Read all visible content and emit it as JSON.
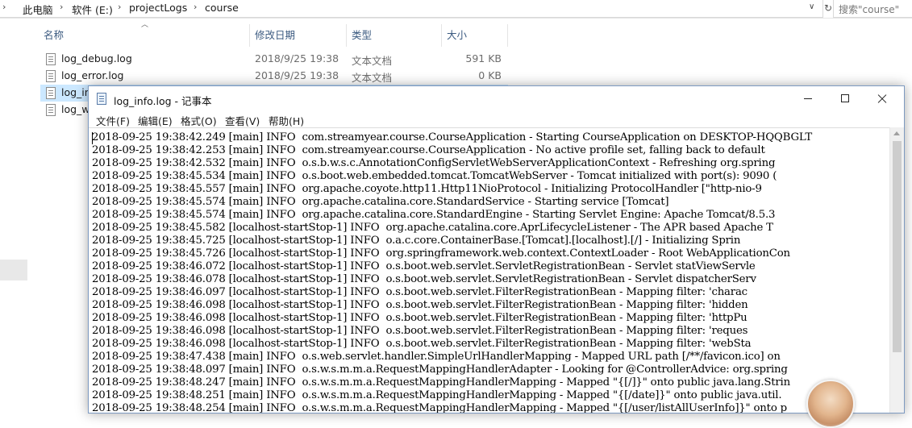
{
  "explorer": {
    "breadcrumb": [
      "此电脑",
      "软件 (E:)",
      "projectLogs",
      "course"
    ],
    "search_placeholder": "搜索\"course\"",
    "columns": [
      "名称",
      "修改日期",
      "类型",
      "大小"
    ],
    "files": [
      {
        "name": "log_debug.log",
        "date": "2018/9/25 19:38",
        "type": "文本文档",
        "size": "591 KB"
      },
      {
        "name": "log_error.log",
        "date": "2018/9/25 19:38",
        "type": "文本文档",
        "size": "0 KB"
      },
      {
        "name": "log_in",
        "date": "",
        "type": "",
        "size": ""
      },
      {
        "name": "log_w",
        "date": "",
        "type": "",
        "size": ""
      }
    ]
  },
  "notepad": {
    "title": "log_info.log - 记事本",
    "menus": [
      "文件(F)",
      "编辑(E)",
      "格式(O)",
      "查看(V)",
      "帮助(H)"
    ],
    "lines": [
      "2018-09-25 19:38:42.249 [main] INFO  com.streamyear.course.CourseApplication - Starting CourseApplication on DESKTOP-HQQBGLT",
      "2018-09-25 19:38:42.253 [main] INFO  com.streamyear.course.CourseApplication - No active profile set, falling back to default",
      "2018-09-25 19:38:42.532 [main] INFO  o.s.b.w.s.c.AnnotationConfigServletWebServerApplicationContext - Refreshing org.spring",
      "2018-09-25 19:38:45.534 [main] INFO  o.s.boot.web.embedded.tomcat.TomcatWebServer - Tomcat initialized with port(s): 9090 (",
      "2018-09-25 19:38:45.557 [main] INFO  org.apache.coyote.http11.Http11NioProtocol - Initializing ProtocolHandler [\"http-nio-9",
      "2018-09-25 19:38:45.574 [main] INFO  org.apache.catalina.core.StandardService - Starting service [Tomcat]",
      "2018-09-25 19:38:45.574 [main] INFO  org.apache.catalina.core.StandardEngine - Starting Servlet Engine: Apache Tomcat/8.5.3",
      "2018-09-25 19:38:45.582 [localhost-startStop-1] INFO  org.apache.catalina.core.AprLifecycleListener - The APR based Apache T",
      "2018-09-25 19:38:45.725 [localhost-startStop-1] INFO  o.a.c.core.ContainerBase.[Tomcat].[localhost].[/] - Initializing Sprin",
      "2018-09-25 19:38:45.726 [localhost-startStop-1] INFO  org.springframework.web.context.ContextLoader - Root WebApplicationCon",
      "2018-09-25 19:38:46.072 [localhost-startStop-1] INFO  o.s.boot.web.servlet.ServletRegistrationBean - Servlet statViewServle",
      "2018-09-25 19:38:46.078 [localhost-startStop-1] INFO  o.s.boot.web.servlet.ServletRegistrationBean - Servlet dispatcherServ",
      "2018-09-25 19:38:46.097 [localhost-startStop-1] INFO  o.s.boot.web.servlet.FilterRegistrationBean - Mapping filter: 'charac",
      "2018-09-25 19:38:46.098 [localhost-startStop-1] INFO  o.s.boot.web.servlet.FilterRegistrationBean - Mapping filter: 'hidden",
      "2018-09-25 19:38:46.098 [localhost-startStop-1] INFO  o.s.boot.web.servlet.FilterRegistrationBean - Mapping filter: 'httpPu",
      "2018-09-25 19:38:46.098 [localhost-startStop-1] INFO  o.s.boot.web.servlet.FilterRegistrationBean - Mapping filter: 'reques",
      "2018-09-25 19:38:46.098 [localhost-startStop-1] INFO  o.s.boot.web.servlet.FilterRegistrationBean - Mapping filter: 'webSta",
      "2018-09-25 19:38:47.438 [main] INFO  o.s.web.servlet.handler.SimpleUrlHandlerMapping - Mapped URL path [/**/favicon.ico] on",
      "2018-09-25 19:38:48.097 [main] INFO  o.s.w.s.m.m.a.RequestMappingHandlerAdapter - Looking for @ControllerAdvice: org.spring",
      "2018-09-25 19:38:48.247 [main] INFO  o.s.w.s.m.m.a.RequestMappingHandlerMapping - Mapped \"{[/]}\" onto public java.lang.Strin",
      "2018-09-25 19:38:48.251 [main] INFO  o.s.w.s.m.m.a.RequestMappingHandlerMapping - Mapped \"{[/date]}\" onto public java.util.",
      "2018-09-25 19:38:48.254 [main] INFO  o.s.w.s.m.m.a.RequestMappingHandlerMapping - Mapped \"{[/user/listAllUserInfo]}\" onto p"
    ]
  }
}
